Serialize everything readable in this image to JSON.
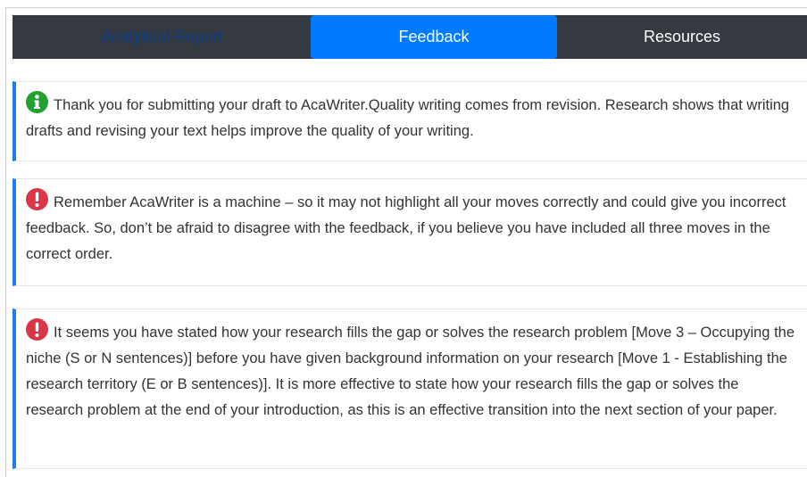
{
  "tabs": [
    {
      "label": "Analytical Report"
    },
    {
      "label": "Feedback"
    },
    {
      "label": "Resources"
    }
  ],
  "feedback": [
    {
      "icon": "info-icon",
      "text": "Thank you for submitting your draft to AcaWriter.Quality writing comes from revision. Research shows that writing drafts and revising your text helps improve the quality of your writing."
    },
    {
      "icon": "alert-icon",
      "text": "Remember AcaWriter is a machine – so it may not highlight all your moves correctly and could give you incorrect feedback. So, don’t be afraid to disagree with the feedback, if you believe you have included all three moves in the correct order."
    },
    {
      "icon": "alert-icon",
      "text": "It seems you have stated how your research fills the gap or solves the research problem [Move 3 – Occupying the niche (S or N sentences)] before you have given background information on your research [Move 1 - Establishing the research territory (E or B sentences)]. It is more effective to state how your research fills the gap or solves the research problem at the end of your introduction, as this is an effective transition into the next section of your paper."
    }
  ],
  "colors": {
    "tabbar_bg": "#343a40",
    "active_tab_bg": "#007bff",
    "info_icon": "#22a132",
    "alert_icon": "#dc3545",
    "card_accent": "#1a7df0"
  }
}
